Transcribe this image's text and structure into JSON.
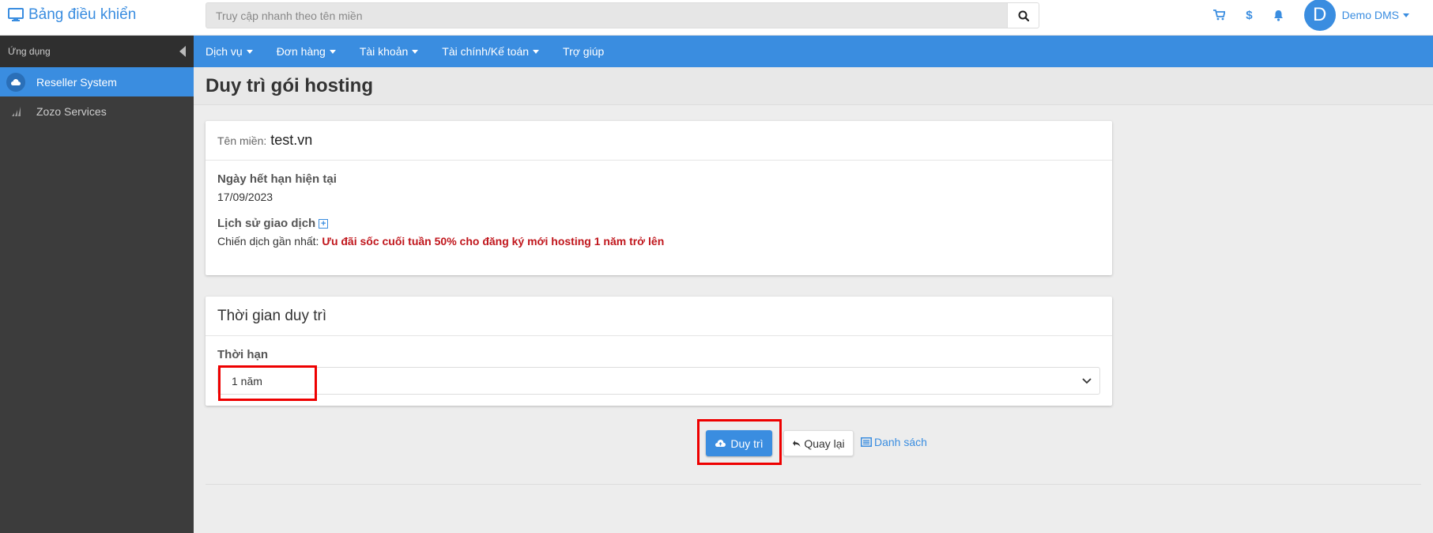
{
  "header": {
    "brand": "Bảng điều khiển",
    "search_placeholder": "Truy cập nhanh theo tên miền",
    "currency_symbol": "$",
    "avatar_letter": "D",
    "user_name": "Demo DMS"
  },
  "sidebar": {
    "header": "Ứng dụng",
    "items": [
      {
        "label": "Reseller System",
        "active": true,
        "icon": "cloud-icon"
      },
      {
        "label": "Zozo Services",
        "active": false,
        "icon": "bar-chart-icon"
      }
    ]
  },
  "nav": {
    "items": [
      "Dịch vụ",
      "Đơn hàng",
      "Tài khoản",
      "Tài chính/Kế toán",
      "Trợ giúp"
    ]
  },
  "page": {
    "title": "Duy trì gói hosting"
  },
  "info_card": {
    "domain_label": "Tên miền:",
    "domain_value": "test.vn",
    "expiry_label": "Ngày hết hạn hiện tại",
    "expiry_value": "17/09/2023",
    "history_label": "Lịch sử giao dịch",
    "history_toggle": "+",
    "campaign_prefix": "Chiến dịch gần nhất:",
    "campaign_name": "Ưu đãi sốc cuối tuần 50% cho đăng ký mới hosting 1 năm trở lên"
  },
  "term_card": {
    "title": "Thời gian duy trì",
    "term_label": "Thời hạn",
    "term_value": "1 năm"
  },
  "actions": {
    "renew": "Duy trì",
    "back": "Quay lại",
    "list": "Danh sách"
  },
  "colors": {
    "accent": "#3a8de0",
    "campaign": "#c0161c",
    "highlight": "#e00000"
  }
}
